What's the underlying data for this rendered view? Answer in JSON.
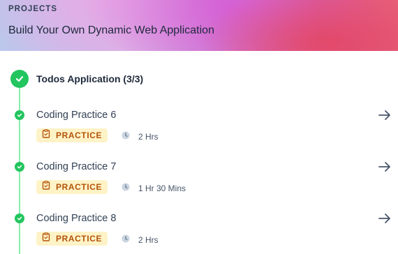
{
  "header": {
    "kicker": "PROJECTS",
    "title": "Build Your Own Dynamic Web Application"
  },
  "section": {
    "title": "Todos Application (3/3)"
  },
  "items": [
    {
      "title": "Coding Practice 6",
      "badge": "PRACTICE",
      "duration": "2 Hrs"
    },
    {
      "title": "Coding Practice 7",
      "badge": "PRACTICE",
      "duration": "1 Hr 30 Mins"
    },
    {
      "title": "Coding Practice 8",
      "badge": "PRACTICE",
      "duration": "2 Hrs"
    }
  ],
  "colors": {
    "success": "#22c55e",
    "badge_bg": "#fef3c7",
    "badge_text": "#b45309"
  },
  "icons": [
    "check-icon",
    "arrow-right-icon",
    "clipboard-icon",
    "clock-icon"
  ]
}
